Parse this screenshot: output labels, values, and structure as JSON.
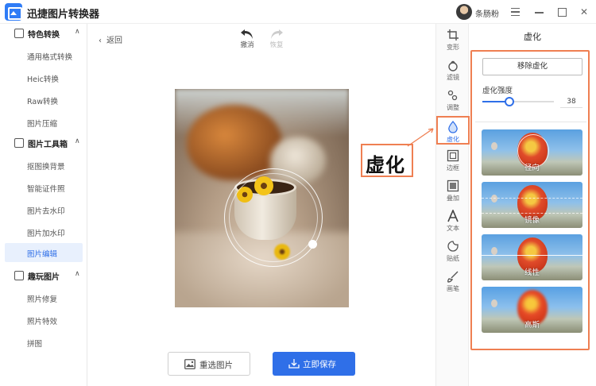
{
  "app": {
    "title": "迅捷图片转换器",
    "username": "条肠粉"
  },
  "sidebar": {
    "groups": [
      {
        "label": "特色转换",
        "items": [
          "通用格式转换",
          "Heic转换",
          "Raw转换",
          "图片压缩"
        ]
      },
      {
        "label": "图片工具箱",
        "items": [
          "抠图换背景",
          "智能证件照",
          "图片去水印",
          "图片加水印",
          "图片编辑"
        ]
      },
      {
        "label": "趣玩图片",
        "items": [
          "照片修复",
          "照片特效",
          "拼图"
        ]
      }
    ],
    "active_item": "图片编辑"
  },
  "toolbar": {
    "back_label": "返回",
    "undo_label": "撤消",
    "redo_label": "恢复"
  },
  "actions": {
    "reselect_label": "重选图片",
    "save_label": "立即保存"
  },
  "annotation": {
    "callout_label": "虚化"
  },
  "tools": [
    {
      "label": "变形",
      "icon": "crop-icon"
    },
    {
      "label": "滤镜",
      "icon": "filter-icon"
    },
    {
      "label": "调整",
      "icon": "adjust-icon"
    },
    {
      "label": "虚化",
      "icon": "blur-drop-icon",
      "active": true
    },
    {
      "label": "边框",
      "icon": "border-icon"
    },
    {
      "label": "叠加",
      "icon": "overlay-icon"
    },
    {
      "label": "文本",
      "icon": "text-icon"
    },
    {
      "label": "贴纸",
      "icon": "sticker-icon"
    },
    {
      "label": "画笔",
      "icon": "brush-icon"
    }
  ],
  "panel": {
    "title": "虚化",
    "remove_label": "移除虚化",
    "strength_label": "虚化强度",
    "strength_value": "38",
    "strength_fraction": 0.38,
    "presets": [
      "径向",
      "镜像",
      "线性",
      "高斯"
    ]
  },
  "colors": {
    "accent": "#2f6fe8",
    "highlight": "#ef7f52"
  }
}
